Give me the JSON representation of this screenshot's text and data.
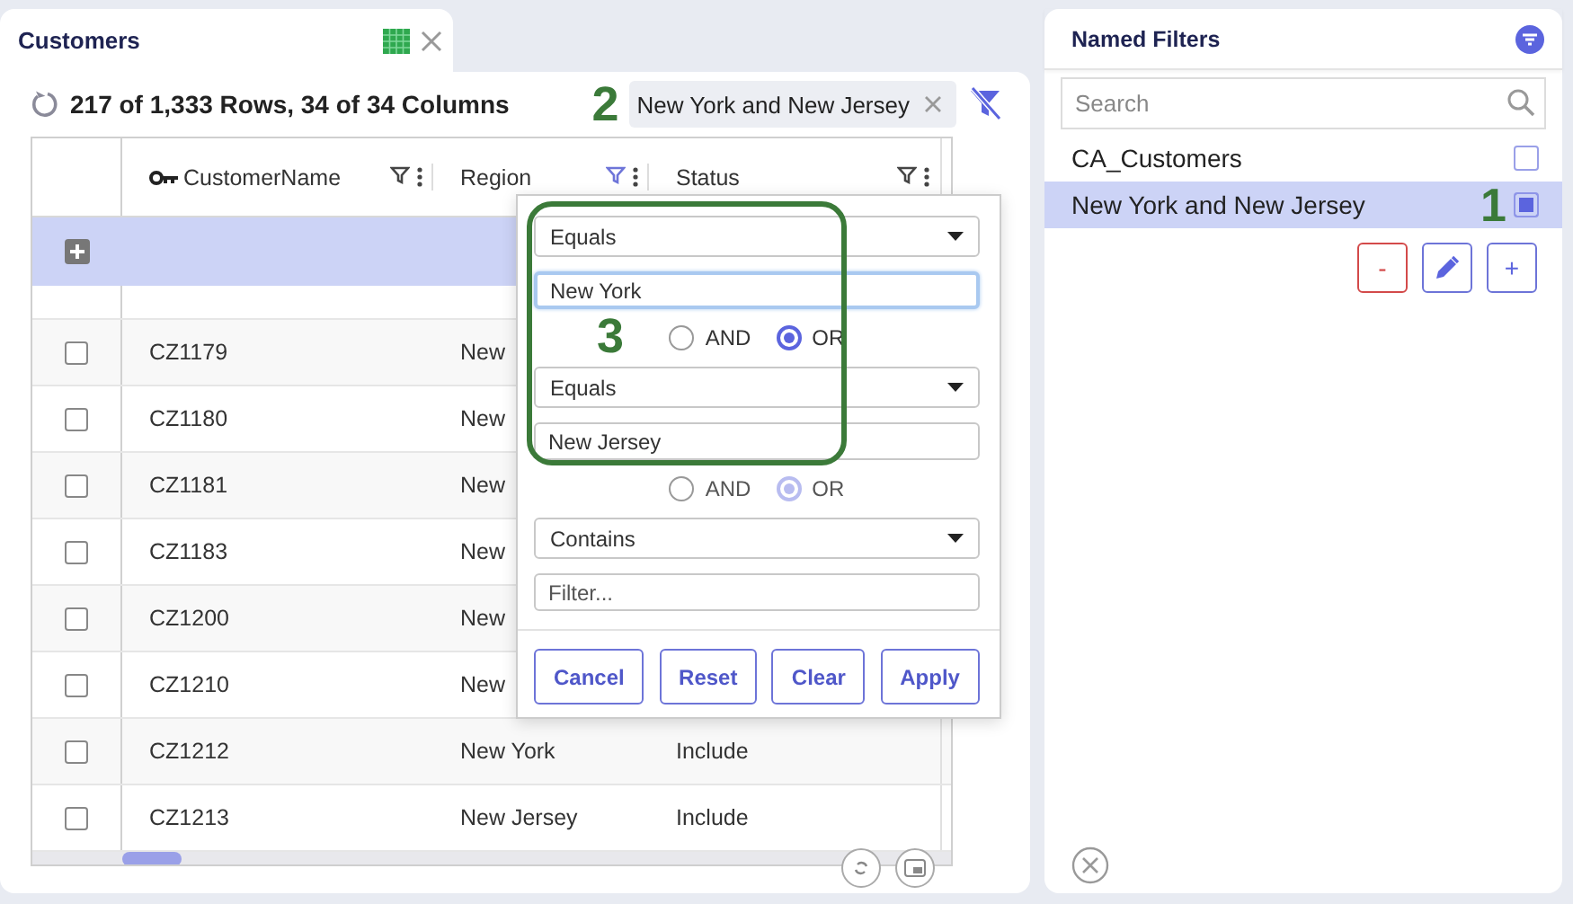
{
  "tab": {
    "title": "Customers"
  },
  "toolbar": {
    "summary": "217 of 1,333 Rows, 34 of 34 Columns",
    "annotation": "2",
    "active_filter": "New York and New Jersey"
  },
  "grid": {
    "columns": [
      {
        "label": "CustomerName",
        "key": true,
        "filter_active": false
      },
      {
        "label": "Region",
        "key": false,
        "filter_active": true
      },
      {
        "label": "Status",
        "key": false,
        "filter_active": false
      }
    ],
    "rows": [
      {
        "checked": false,
        "cells": [
          "CZ1179",
          "New"
        ]
      },
      {
        "checked": false,
        "cells": [
          "CZ1180",
          "New"
        ]
      },
      {
        "checked": false,
        "cells": [
          "CZ1181",
          "New"
        ]
      },
      {
        "checked": false,
        "cells": [
          "CZ1183",
          "New"
        ]
      },
      {
        "checked": false,
        "cells": [
          "CZ1200",
          "New"
        ]
      },
      {
        "checked": false,
        "cells": [
          "CZ1210",
          "New"
        ]
      },
      {
        "checked": false,
        "cells": [
          "CZ1212",
          "New York",
          "Include"
        ]
      },
      {
        "checked": false,
        "cells": [
          "CZ1213",
          "New Jersey",
          "Include"
        ]
      }
    ]
  },
  "filter_popup": {
    "annotation": "3",
    "conditions": [
      {
        "operator": "Equals",
        "value": "New York",
        "focused": true
      },
      {
        "operator": "Equals",
        "value": "New Jersey",
        "focused": false
      },
      {
        "operator": "Contains",
        "placeholder": "Filter...",
        "focused": false
      }
    ],
    "joins": [
      {
        "disabled": false,
        "options": [
          {
            "label": "AND",
            "selected": false
          },
          {
            "label": "OR",
            "selected": true
          }
        ]
      },
      {
        "disabled": true,
        "options": [
          {
            "label": "AND",
            "selected": false
          },
          {
            "label": "OR",
            "selected": true
          }
        ]
      }
    ],
    "buttons": [
      "Cancel",
      "Reset",
      "Clear",
      "Apply"
    ]
  },
  "named_filters": {
    "title": "Named Filters",
    "search": {
      "placeholder": "Search"
    },
    "items": [
      {
        "label": "CA_Customers",
        "selected": false,
        "checked": false
      },
      {
        "label": "New York and New Jersey",
        "selected": true,
        "checked": true,
        "annotation": "1"
      }
    ],
    "buttons": [
      {
        "kind": "remove",
        "label": "-"
      },
      {
        "kind": "edit"
      },
      {
        "kind": "add",
        "label": "+"
      }
    ]
  }
}
